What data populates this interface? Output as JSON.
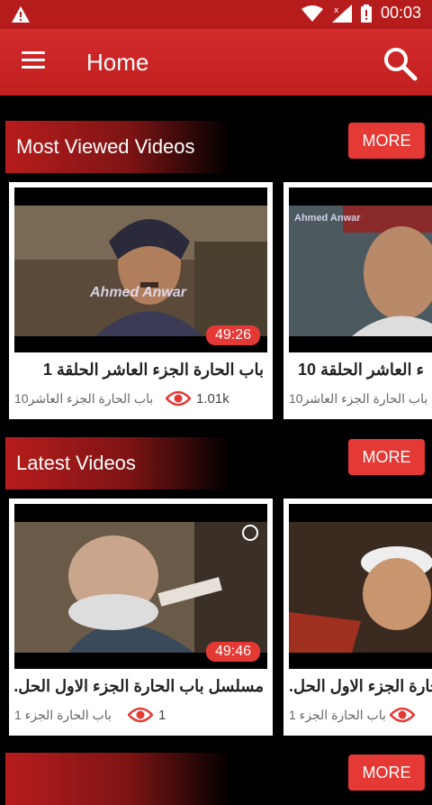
{
  "status": {
    "time": "00:03"
  },
  "appbar": {
    "title": "Home"
  },
  "sections": [
    {
      "title": "Most Viewed Videos",
      "more": "MORE",
      "videos": [
        {
          "duration": "49:26",
          "title": "باب الحارة الجزء العاشر الحلقة 1",
          "subtitle": "باب الحارة الجزء العاشر10",
          "views": "1.01k",
          "watermark": "Ahmed Anwar"
        },
        {
          "duration": "",
          "title": "ء العاشر الحلقة 10",
          "subtitle": "باب الحارة الجزء العاشر10",
          "views": "",
          "watermark": "Ahmed Anwar"
        }
      ]
    },
    {
      "title": "Latest Videos",
      "more": "MORE",
      "videos": [
        {
          "duration": "49:46",
          "title": "مسلسل باب الحارة الجزء الاول الحل.",
          "subtitle": "باب الحارة الجزء 1",
          "views": "1",
          "watermark": ""
        },
        {
          "duration": "",
          "title": "حارة الجزء الاول الحل.",
          "subtitle": "باب الحارة الجزء 1",
          "views": "",
          "watermark": ""
        }
      ]
    },
    {
      "title": "",
      "more": "MORE",
      "videos": []
    }
  ],
  "icons": {
    "menu": "menu-icon",
    "search": "search-icon",
    "eye": "eye-icon",
    "warning": "warning-icon"
  },
  "colors": {
    "primary": "#c62828",
    "accent": "#e53935"
  }
}
